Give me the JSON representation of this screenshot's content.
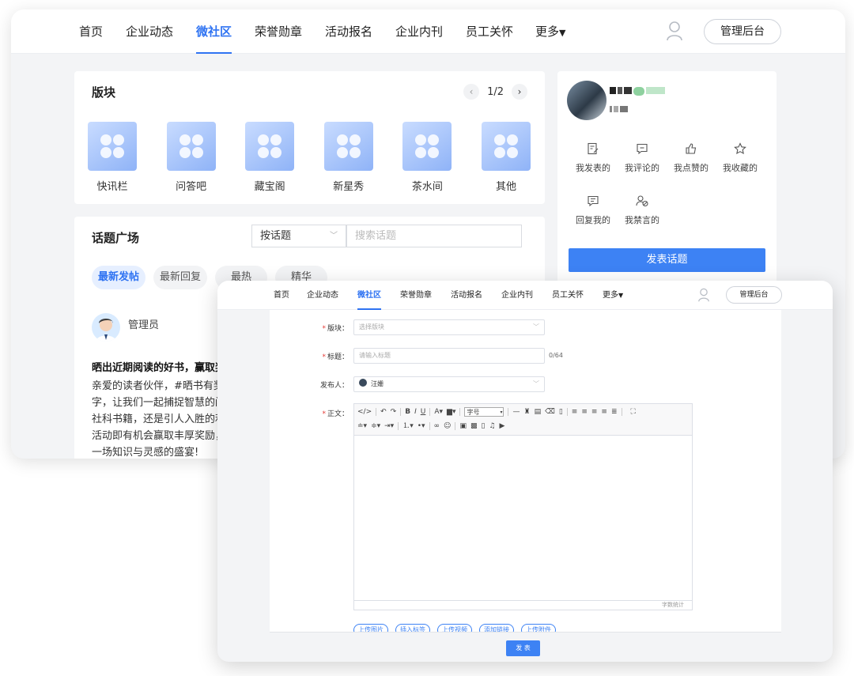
{
  "nav": {
    "items": [
      "首页",
      "企业动态",
      "微社区",
      "荣誉勋章",
      "活动报名",
      "企业内刊",
      "员工关怀",
      "更多"
    ],
    "active_index": 2,
    "admin_label": "管理后台"
  },
  "boards": {
    "title": "版块",
    "page": "1/2",
    "items": [
      "快讯栏",
      "问答吧",
      "藏宝阁",
      "新星秀",
      "茶水间",
      "其他"
    ]
  },
  "topics": {
    "title": "话题广场",
    "filter_value": "按话题",
    "search_placeholder": "搜索话题",
    "tabs": [
      "最新发帖",
      "最新回复",
      "最热",
      "精华"
    ],
    "post": {
      "author": "管理员",
      "title": "晒出近期阅读的好书，赢取奖",
      "body_lines": [
        "亲爱的读者伙伴，#晒书有奖",
        "字，让我们一起捕捉智慧的闪",
        "社科书籍，还是引人入胜的利",
        "活动即有机会赢取丰厚奖励，",
        "一场知识与灵感的盛宴!"
      ]
    }
  },
  "profile": {
    "quick_links": [
      "我发表的",
      "我评论的",
      "我点赞的",
      "我收藏的",
      "回复我的",
      "我禁言的"
    ],
    "publish_label": "发表话题"
  },
  "form": {
    "board_label": "版块：",
    "board_placeholder": "选择版块",
    "title_label": "标题：",
    "title_placeholder": "请输入标题",
    "title_count": "0/64",
    "publisher_label": "发布人：",
    "publisher_value": "汪姗",
    "body_label": "正文：",
    "font_size_label": "字号",
    "word_count_label": "字数统计",
    "chips": [
      "上传图片",
      "插入标签",
      "上传视频",
      "添加链接",
      "上传附件"
    ],
    "submit_label": "发 表"
  },
  "colors": {
    "accent": "#2f73f2",
    "button": "#3d82f4",
    "page_bg": "#f3f4f6"
  }
}
